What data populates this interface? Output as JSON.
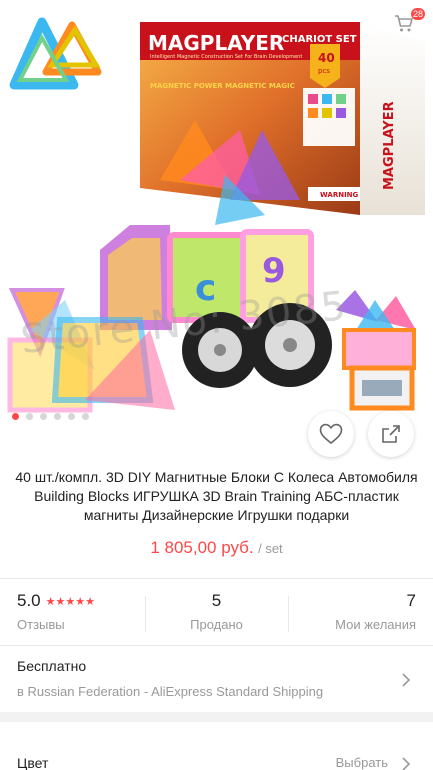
{
  "header": {
    "back_icon": "chevron-left-icon",
    "cart_icon": "cart-icon",
    "cart_count": "28"
  },
  "gallery": {
    "image_count": 6,
    "active_index": 0,
    "box_brand": "MAGPLAYER",
    "box_subtitle": "CHARIOT SET",
    "box_pieces": "40",
    "box_pieces_unit": "pcs",
    "box_tagline": "Intelligent Magnetic Construction Set For Brain Development",
    "box_power": "MAGNETIC POWER MAGNETIC MAGIC",
    "box_warning": "WARNING",
    "block_letter_c": "c",
    "block_digit_9": "9",
    "watermark": "Store No: 3085"
  },
  "actions": {
    "wishlist_icon": "heart-icon",
    "share_icon": "share-icon"
  },
  "product": {
    "title": "40 шт./компл. 3D DIY Магнитные Блоки С Колеса Автомобиля Building Blocks ИГРУШКА 3D Brain Training АБС-пластик магниты Дизайнерские Игрушки подарки",
    "price": "1 805,00 руб.",
    "price_unit": "/ set"
  },
  "stats": {
    "rating_value": "5.0",
    "rating_stars": "★★★★★",
    "rating_label": "Отзывы",
    "sold_value": "5",
    "sold_label": "Продано",
    "wish_value": "7",
    "wish_label": "Мои желания"
  },
  "shipping": {
    "title": "Бесплатно",
    "detail": "в Russian Federation - AliExpress Standard Shipping"
  },
  "color": {
    "label": "Цвет",
    "action": "Выбрать"
  },
  "colors": {
    "accent": "#ff4747",
    "muted": "#999999"
  }
}
